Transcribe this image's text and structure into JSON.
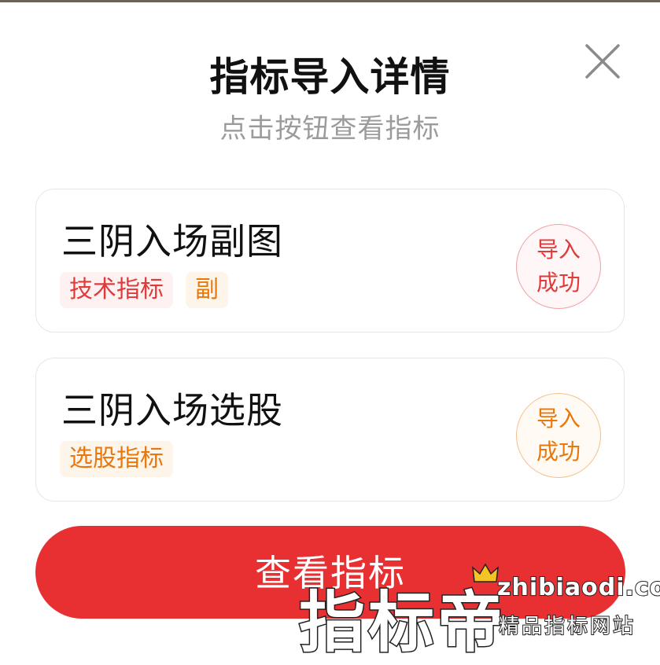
{
  "dialog": {
    "title": "指标导入详情",
    "subtitle": "点击按钮查看指标",
    "close_icon": "close-icon"
  },
  "items": [
    {
      "name": "三阴入场副图",
      "tags": [
        "技术指标",
        "副"
      ],
      "status": [
        "导入",
        "成功"
      ],
      "status_color": "#e03a3a"
    },
    {
      "name": "三阴入场选股",
      "tags": [
        "选股指标"
      ],
      "status": [
        "导入",
        "成功"
      ],
      "status_color": "#e8780c"
    }
  ],
  "cta": {
    "label": "查看指标",
    "color": "#e83033"
  },
  "watermark": {
    "brand": "指标帝",
    "domain": "zhibiaodi.com",
    "slogan": "精品指标网站",
    "crown_icon": "crown-icon"
  }
}
